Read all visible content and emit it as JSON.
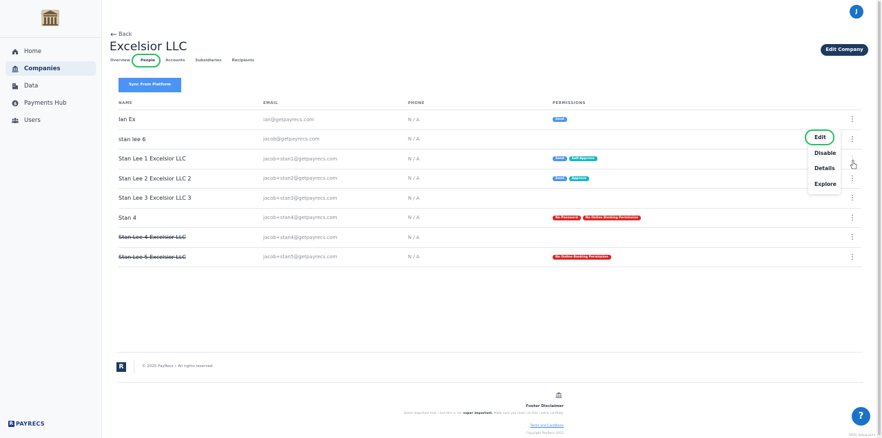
{
  "sidebar": {
    "items": [
      {
        "label": "Home",
        "icon": "home-icon"
      },
      {
        "label": "Companies",
        "icon": "bank-icon",
        "active": true
      },
      {
        "label": "Data",
        "icon": "building-icon"
      },
      {
        "label": "Payments Hub",
        "icon": "dollar-icon"
      },
      {
        "label": "Users",
        "icon": "users-icon"
      }
    ],
    "brand": "PAYRECS"
  },
  "header": {
    "avatar_initial": "J",
    "back_label": "Back",
    "title": "Excelsior LLC",
    "edit_company_label": "Edit Company",
    "tabs": [
      "Overview",
      "People",
      "Accounts",
      "Subsidiaries",
      "Recipients"
    ],
    "active_tab": "People"
  },
  "toolbar": {
    "sync_label": "Sync From Platform"
  },
  "table": {
    "headers": [
      "NAME",
      "EMAIL",
      "PHONE",
      "PERMISSIONS"
    ],
    "rows": [
      {
        "name": "Ian Ex",
        "email": "ian@getpayrecs.com",
        "phone": "N / A",
        "badges": [
          {
            "text": "Send",
            "color": "blue"
          }
        ]
      },
      {
        "name": "stan lee 6",
        "email": "jacob@getpayrecs.com",
        "phone": "N / A",
        "badges": []
      },
      {
        "name": "Stan Lee 1 Excelsior LLC",
        "email": "jacob+stan1@getpayrecs.com",
        "phone": "N / A",
        "badges": [
          {
            "text": "Send",
            "color": "blue"
          },
          {
            "text": "Self-Approve",
            "color": "teal"
          }
        ]
      },
      {
        "name": "Stan Lee 2 Excelsior LLC 2",
        "email": "jacob+stan2@getpayrecs.com",
        "phone": "N / A",
        "badges": [
          {
            "text": "Send",
            "color": "blue"
          },
          {
            "text": "Approve",
            "color": "teal"
          }
        ]
      },
      {
        "name": "Stan Lee 3 Excelsior LLC 3",
        "email": "jacob+stan3@getpayrecs.com",
        "phone": "N / A",
        "badges": []
      },
      {
        "name": "Stan 4",
        "email": "jacob+stan4@getpayrecs.com",
        "phone": "N / A",
        "badges": [
          {
            "text": "No Password",
            "color": "red"
          },
          {
            "text": "No Online Banking Permission",
            "color": "red"
          }
        ]
      },
      {
        "name": "Stan Lee 4 Excelsior LLC",
        "email": "jacob+stan4@getpayrecs.com",
        "phone": "N / A",
        "badges": [],
        "disabled": true
      },
      {
        "name": "Stan Lee 5 Excelsior LLC",
        "email": "jacob+stan5@getpayrecs.com",
        "phone": "N / A",
        "badges": [
          {
            "text": "No Online Banking Permission",
            "color": "red"
          }
        ],
        "disabled": true
      }
    ]
  },
  "row_menu": {
    "items": [
      "Edit",
      "Disable",
      "Details",
      "Explore"
    ]
  },
  "footer": {
    "copyright": "© 2025 PayRecs  •  All rights reserved",
    "disclaimer_title": "Footer Disclaimer",
    "disclaimer_pre": "Some important text, \\ but this is -len ",
    "disclaimer_bold": "super important.",
    "disclaimer_post": " Make sure you read i on this \\ extra carefully.",
    "terms_link": "Terms and Conditions",
    "disclaimer_copy": "Copyright PayRecs 2022",
    "version": "REDG_debug.pod ▾"
  },
  "colors": {
    "accent": "#1e3a5f",
    "primary_button": "#4b93f5",
    "highlight": "#22c55e",
    "badge_blue": "#4b93f5",
    "badge_teal": "#16b7c4",
    "badge_red": "#dc2626"
  }
}
